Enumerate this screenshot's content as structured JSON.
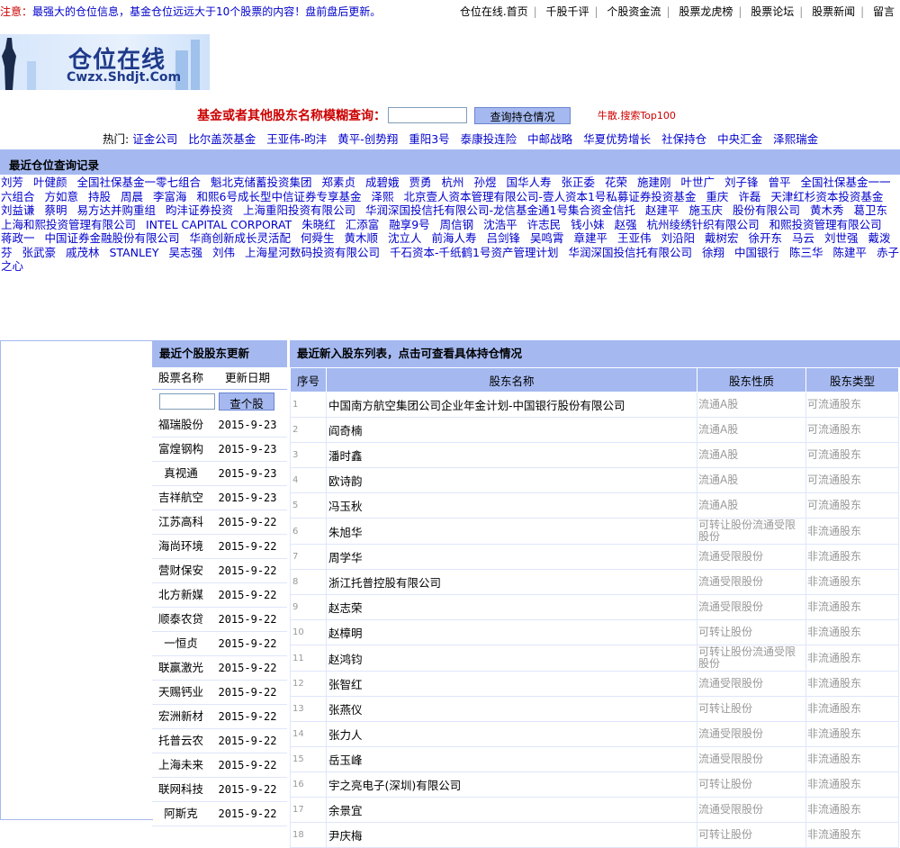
{
  "topbar": {
    "notice_prefix": "注意：",
    "notice": "最强大的仓位信息，基金仓位远远大于10个股票的内容！盘前盘后更新。",
    "nav": [
      "仓位在线.首页",
      "千股千评",
      "个股资金流",
      "股票龙虎榜",
      "股票论坛",
      "股票新闻",
      "留言"
    ]
  },
  "logo": {
    "title": "仓位在线",
    "url": "Cwzx.Shdjt.Com"
  },
  "search": {
    "label": "基金或者其他股东名称模糊查询：",
    "input_value": "",
    "button": "查询持仓情况",
    "top100": "牛散.搜索Top100"
  },
  "hot": {
    "label": "热门:",
    "items": [
      "证金公司",
      "比尔盖茨基金",
      "王亚伟-昀沣",
      "黄平-创势翔",
      "重阳3号",
      "泰康投连险",
      "中邮战略",
      "华夏优势增长",
      "社保持仓",
      "中央汇金",
      "泽熙瑞金"
    ]
  },
  "recent": {
    "title": "最近仓位查询记录",
    "items": [
      "刘芳",
      "叶健颜",
      "全国社保基金一零七组合",
      "魁北克储蓄投资集团",
      "郑素贞",
      "成碧娥",
      "贾勇",
      "杭州",
      "孙煜",
      "国华人寿",
      "张正委",
      "花荣",
      "施建刚",
      "叶世广",
      "刘子锋",
      "曾平",
      "全国社保基金一一六组合",
      "方如意",
      "持股",
      "周晨",
      "李富海",
      "和熙6号成长型中信证券专享基金",
      "泽熙",
      "北京壹人资本管理有限公司-壹人资本1号私募证券投资基金",
      "重庆",
      "许磊",
      "天津红杉资本投资基金",
      "刘益谦",
      "蔡明",
      "易方达并购重组",
      "昀沣证券投资",
      "上海重阳投资有限公司",
      "华润深国投信托有限公司-龙信基金通1号集合资金信托",
      "赵建平",
      "施玉庆",
      "股份有限公司",
      "黄木秀",
      "葛卫东",
      "上海和熙投资管理有限公司",
      "INTEL CAPITAL CORPORAT",
      "朱晓红",
      "汇添富",
      "融享9号",
      "周信钢",
      "沈浩平",
      "许志民",
      "钱小妹",
      "赵强",
      "杭州绫绣针织有限公司",
      "和熙投资管理有限公司",
      "蒋政一",
      "中国证券金融股份有限公司",
      "华商创新成长灵活配",
      "何舜生",
      "黄木顺",
      "沈立人",
      "前海人寿",
      "吕剑锋",
      "吴鸣霄",
      "章建平",
      "王亚伟",
      "刘沿阳",
      "戴树宏",
      "徐开东",
      "马云",
      "刘世强",
      "戴泼芬",
      "张武豪",
      "戚茂林",
      "STANLEY",
      "吴志强",
      "刘伟",
      "上海星河数码投资有限公司",
      "千石资本-千纸鹤1号资产管理计划",
      "华润深国投信托有限公司",
      "徐翔",
      "中国银行",
      "陈三华",
      "陈建平",
      "赤子之心"
    ]
  },
  "side": {
    "title": "最近个股股东更新",
    "col_name": "股票名称",
    "col_date": "更新日期",
    "input_value": "",
    "button": "查个股",
    "rows": [
      [
        "福瑞股份",
        "2015-9-23"
      ],
      [
        "富煌钢构",
        "2015-9-23"
      ],
      [
        "真视通",
        "2015-9-23"
      ],
      [
        "吉祥航空",
        "2015-9-23"
      ],
      [
        "江苏高科",
        "2015-9-22"
      ],
      [
        "海尚环境",
        "2015-9-22"
      ],
      [
        "营财保安",
        "2015-9-22"
      ],
      [
        "北方新媒",
        "2015-9-22"
      ],
      [
        "顺泰农贷",
        "2015-9-22"
      ],
      [
        "一恒贞",
        "2015-9-22"
      ],
      [
        "联赢激光",
        "2015-9-22"
      ],
      [
        "天赐钙业",
        "2015-9-22"
      ],
      [
        "宏洲新材",
        "2015-9-22"
      ],
      [
        "托普云农",
        "2015-9-22"
      ],
      [
        "上海未来",
        "2015-9-22"
      ],
      [
        "联网科技",
        "2015-9-22"
      ],
      [
        "阿斯克",
        "2015-9-22"
      ]
    ]
  },
  "main": {
    "title": "最近新入股东列表，点击可查看具体持仓情况",
    "columns": [
      "序号",
      "股东名称",
      "股东性质",
      "股东类型"
    ],
    "rows": [
      [
        "1",
        "中国南方航空集团公司企业年金计划-中国银行股份有限公司",
        "流通A股",
        "可流通股东"
      ],
      [
        "2",
        "阎奇楠",
        "流通A股",
        "可流通股东"
      ],
      [
        "3",
        "潘时鑫",
        "流通A股",
        "可流通股东"
      ],
      [
        "4",
        "欧诗韵",
        "流通A股",
        "可流通股东"
      ],
      [
        "5",
        "冯玉秋",
        "流通A股",
        "可流通股东"
      ],
      [
        "6",
        "朱旭华",
        "可转让股份流通受限股份",
        "非流通股东"
      ],
      [
        "7",
        "周学华",
        "流通受限股份",
        "非流通股东"
      ],
      [
        "8",
        "浙江托普控股有限公司",
        "流通受限股份",
        "非流通股东"
      ],
      [
        "9",
        "赵志荣",
        "流通受限股份",
        "非流通股东"
      ],
      [
        "10",
        "赵樟明",
        "可转让股份",
        "非流通股东"
      ],
      [
        "11",
        "赵鸿钧",
        "可转让股份流通受限股份",
        "非流通股东"
      ],
      [
        "12",
        "张智红",
        "流通受限股份",
        "非流通股东"
      ],
      [
        "13",
        "张燕仪",
        "可转让股份",
        "非流通股东"
      ],
      [
        "14",
        "张力人",
        "流通受限股份",
        "非流通股东"
      ],
      [
        "15",
        "岳玉峰",
        "流通受限股份",
        "非流通股东"
      ],
      [
        "16",
        "宇之亮电子(深圳)有限公司",
        "可转让股份",
        "非流通股东"
      ],
      [
        "17",
        "余景宜",
        "流通受限股份",
        "非流通股东"
      ],
      [
        "18",
        "尹庆梅",
        "可转让股份",
        "非流通股东"
      ]
    ]
  }
}
